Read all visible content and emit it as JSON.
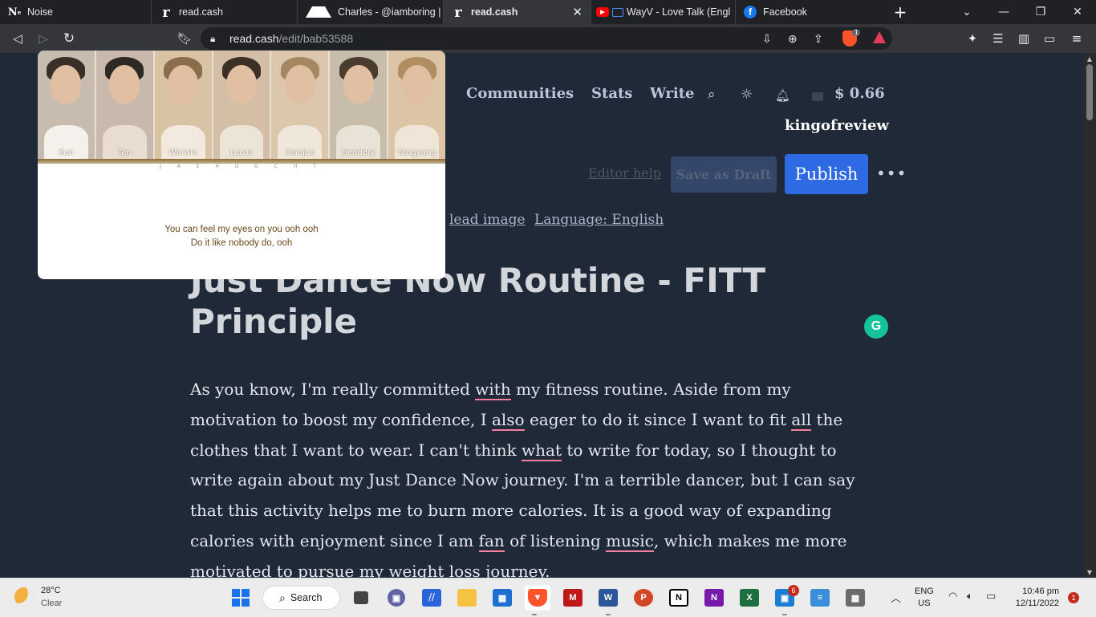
{
  "browser": {
    "tabs": [
      {
        "title": "Noise",
        "favicon": "noise-icon",
        "active": false
      },
      {
        "title": "read.cash",
        "favicon": "read-cash-icon",
        "active": false
      },
      {
        "title": "Charles - @iamboring | Pea",
        "favicon": "peakd-icon",
        "active": false
      },
      {
        "title": "read.cash",
        "favicon": "read-cash-icon",
        "active": true
      },
      {
        "title": "WayV - Love Talk (Englis",
        "favicon": "youtube-icon",
        "active": false
      },
      {
        "title": "Facebook",
        "favicon": "facebook-icon",
        "active": false
      }
    ],
    "url_host": "read.cash",
    "url_path": "/edit/bab53588",
    "brave_shield_count": "1"
  },
  "site": {
    "nav": {
      "communities": "Communities",
      "stats": "Stats",
      "write": "Write"
    },
    "balance": "$ 0.66",
    "username": "kingofreview"
  },
  "editor": {
    "editor_help": "Editor help",
    "save_draft": "Save as Draft",
    "publish": "Publish",
    "lead_image": "lead image",
    "language": "Language: English",
    "title": "Just Dance Now Routine - FITT Principle",
    "body": [
      {
        "t": "As you know, I'm really committed "
      },
      {
        "u": "with"
      },
      {
        "t": " my fitness routine. Aside from my motivation to boost my confidence, I "
      },
      {
        "u": "also"
      },
      {
        "t": " eager to do it since I want to fit "
      },
      {
        "u": "all"
      },
      {
        "t": " the clothes that I want to wear. I can't think "
      },
      {
        "u": "what"
      },
      {
        "t": " to write for today, so I thought to write again about my Just Dance Now journey. I'm a terrible dancer, but I can say that this activity helps me to burn more calories. It is a good way of expanding calories with enjoyment since I am "
      },
      {
        "u": "fan"
      },
      {
        "t": " of listening "
      },
      {
        "u": "music"
      },
      {
        "t": ", which makes me more motivated to pursue my weight loss journey."
      }
    ]
  },
  "pip": {
    "members": [
      "Kun",
      "Ten",
      "Winwin",
      "Lucas",
      "Xiaojun",
      "Hendery",
      "Yangyang"
    ],
    "strip_letters": "J A E H U G C H T",
    "lyric_line1": "You can feel my eyes on you ooh ooh",
    "lyric_line2": "Do it like nobody do, ooh"
  },
  "taskbar": {
    "weather_temp": "28°C",
    "weather_cond": "Clear",
    "search_label": "Search",
    "teams_badge": "6",
    "lang_top": "ENG",
    "lang_bottom": "US",
    "time": "10:46 pm",
    "date": "12/11/2022",
    "notification_count": "1"
  },
  "colors": {
    "page_bg": "#1f2937",
    "publish_bg": "#2d6ae3",
    "grammarly": "#15c39a",
    "underline_suggestion": "#f57f9d"
  }
}
